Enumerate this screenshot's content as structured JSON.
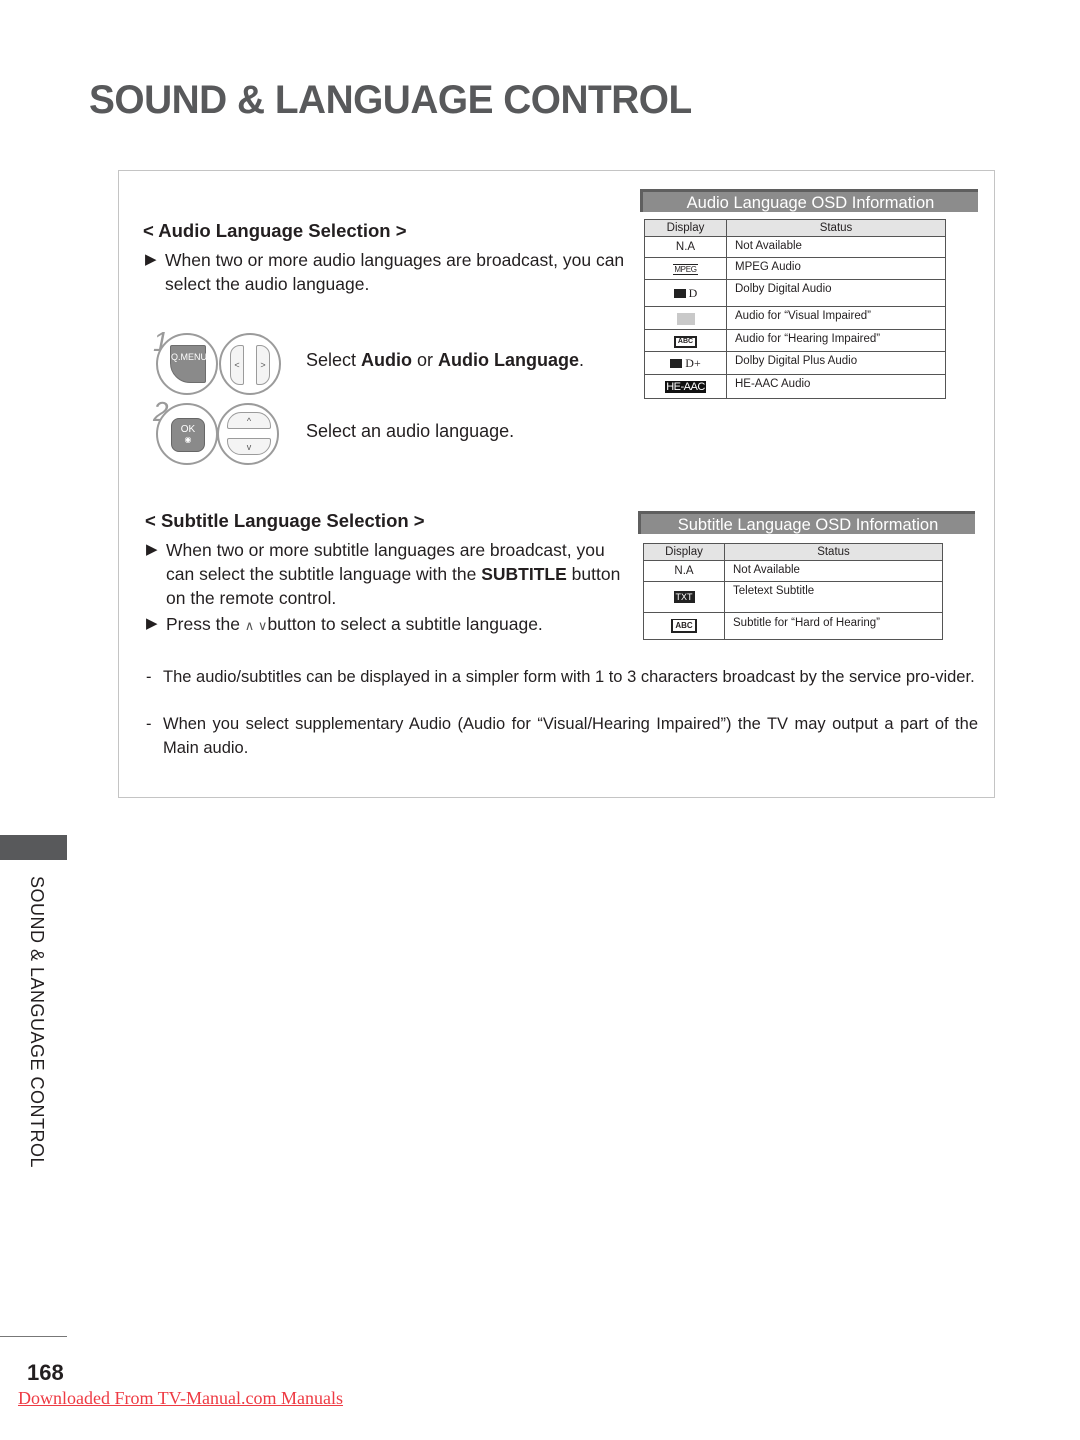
{
  "page_title": "SOUND & LANGUAGE CONTROL",
  "audio_section": {
    "heading": "< Audio Language Selection >",
    "description": "When two or more audio languages are broadcast, you can select the audio language.",
    "steps": [
      {
        "number": "1",
        "buttons": {
          "qmenu": "Q.MENU",
          "left": "<",
          "right": ">"
        },
        "text_before": "Select ",
        "bold1": "Audio",
        "text_mid": " or ",
        "bold2": "Audio Language",
        "text_after": "."
      },
      {
        "number": "2",
        "buttons": {
          "ok": "OK",
          "up": "^",
          "down": "v"
        },
        "text": "Select an audio language."
      }
    ],
    "osd": {
      "title": "Audio Language OSD Information",
      "headers": [
        "Display",
        "Status"
      ],
      "rows": [
        {
          "display": "N.A",
          "icon": "",
          "status": "Not Available"
        },
        {
          "display": "MPEG",
          "icon": "mpeg-icon",
          "status": "MPEG Audio"
        },
        {
          "display": "D",
          "icon": "dolby-digital-icon",
          "status": "Dolby Digital Audio"
        },
        {
          "display": "",
          "icon": "visual-impaired-icon",
          "status": "Audio for “Visual Impaired”"
        },
        {
          "display": "ABC",
          "icon": "hearing-impaired-icon",
          "status": "Audio for “Hearing Impaired”"
        },
        {
          "display": "D+",
          "icon": "dolby-digital-plus-icon",
          "status": "Dolby Digital Plus Audio"
        },
        {
          "display": "HE-AAC",
          "icon": "he-aac-icon",
          "status": "HE-AAC Audio"
        }
      ]
    }
  },
  "subtitle_section": {
    "heading": "< Subtitle Language Selection >",
    "description_before": "When two or more subtitle languages are broadcast, you can select the subtitle language with the ",
    "description_bold": "SUBTITLE",
    "description_after": " button on the remote control.",
    "press_before": "Press the ",
    "press_arrows": "∧ ∨",
    "press_after": "button to select a subtitle language.",
    "osd": {
      "title": "Subtitle Language OSD Information",
      "headers": [
        "Display",
        "Status"
      ],
      "rows": [
        {
          "display": "N.A",
          "icon": "",
          "status": "Not Available"
        },
        {
          "display": "TXT",
          "icon": "teletext-icon",
          "status": "Teletext Subtitle"
        },
        {
          "display": "ABC",
          "icon": "hard-of-hearing-icon",
          "status": "Subtitle for “Hard of Hearing”"
        }
      ]
    }
  },
  "notes": [
    "The audio/subtitles can be displayed in a simpler form with 1 to 3 characters broadcast by the service pro-vider.",
    "When you select supplementary Audio (Audio for “Visual/Hearing Impaired”) the TV may output a part of the Main audio."
  ],
  "bullet_glyph": "▶",
  "dash_glyph": "-",
  "side_label": "SOUND & LANGUAGE CONTROL",
  "page_number": "168",
  "download_link": "Downloaded From TV-Manual.com Manuals",
  "colors": {
    "title": "#58595b",
    "osd_banner": "#8c8c8c",
    "side_tab": "#58595b",
    "link": "#ee3a43"
  }
}
